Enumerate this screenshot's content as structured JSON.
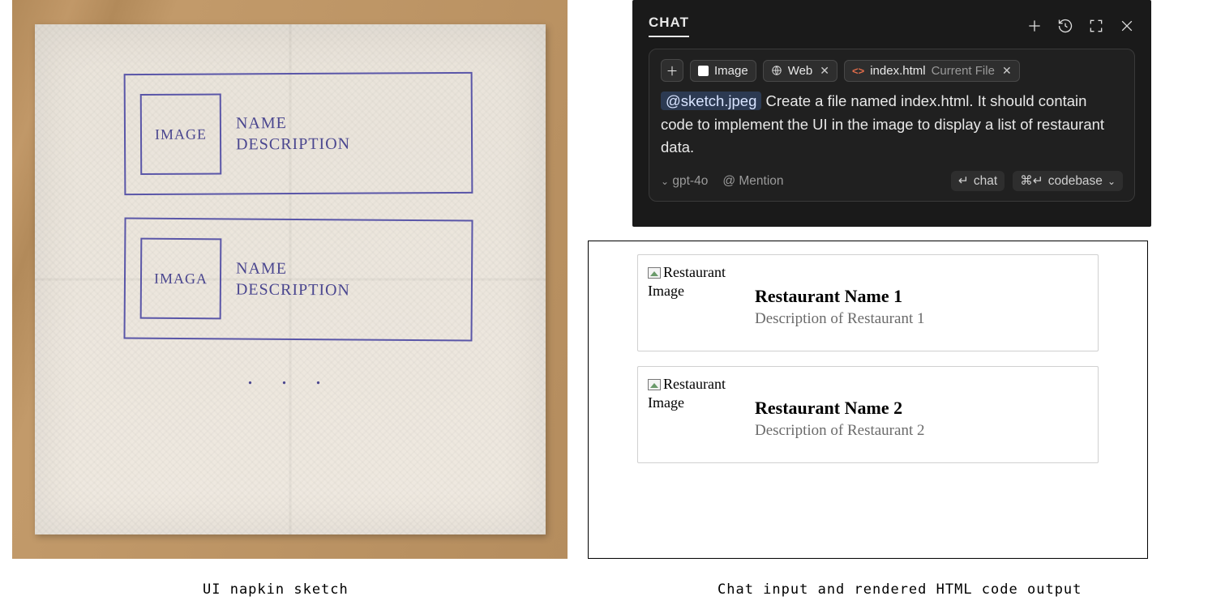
{
  "napkin": {
    "card1": {
      "image_label": "IMAGE",
      "name_label": "NAME",
      "desc_label": "DESCRIPTION"
    },
    "card2": {
      "image_label": "IMAGA",
      "name_label": "NAME",
      "desc_label": "DESCRIPTION"
    },
    "ellipsis": ". . ."
  },
  "captions": {
    "left": "UI napkin sketch",
    "right": "Chat input and rendered HTML code output"
  },
  "chat": {
    "tab_label": "CHAT",
    "chips": {
      "image": "Image",
      "web": "Web",
      "file_name": "index.html",
      "file_status": "Current File"
    },
    "prompt": {
      "mention": "@sketch.jpeg",
      "text_rest": "  Create a file named index.html. It should contain code to implement the UI in the image to display a list of restaurant data."
    },
    "footer": {
      "model": "gpt-4o",
      "mention_label": "@ Mention",
      "chat_label": "chat",
      "codebase_label": "codebase"
    }
  },
  "render": {
    "alt_text": "Restaurant Image",
    "items": [
      {
        "name": "Restaurant Name 1",
        "desc": "Description of Restaurant 1"
      },
      {
        "name": "Restaurant Name 2",
        "desc": "Description of Restaurant 2"
      }
    ]
  }
}
